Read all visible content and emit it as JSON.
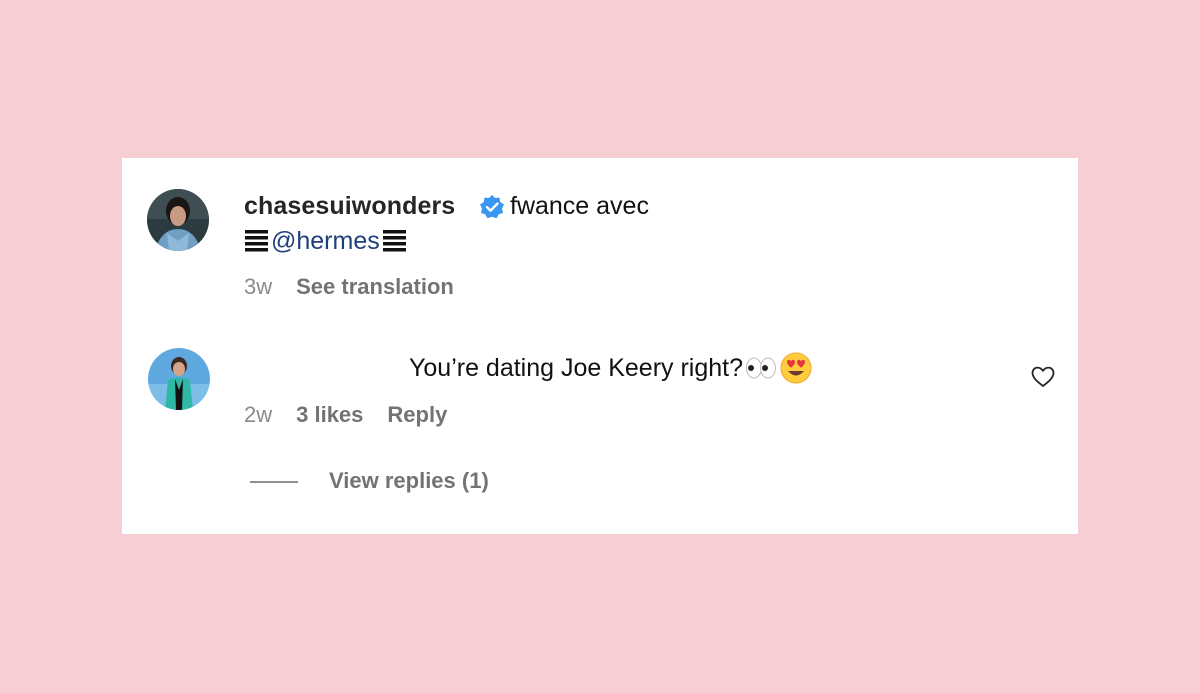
{
  "post_comment": {
    "username": "chasesuiwonders",
    "text": "fwance avec",
    "mention": "@hermes",
    "time": "3w",
    "see_translation": "See translation"
  },
  "reply_comment": {
    "text": "You’re dating Joe Keery right?",
    "time": "2w",
    "likes": "3 likes",
    "reply_label": "Reply",
    "view_replies": "View replies (1)"
  },
  "colors": {
    "page_background": "#f5cfd3",
    "card_background": "#ffffff",
    "verified_blue": "#3897f0",
    "mention_blue": "#1f3f7a",
    "meta_gray": "#737373"
  },
  "icons": [
    "verified-badge-icon",
    "eyes-emoji-icon",
    "heart-eyes-emoji-icon",
    "heart-icon"
  ]
}
